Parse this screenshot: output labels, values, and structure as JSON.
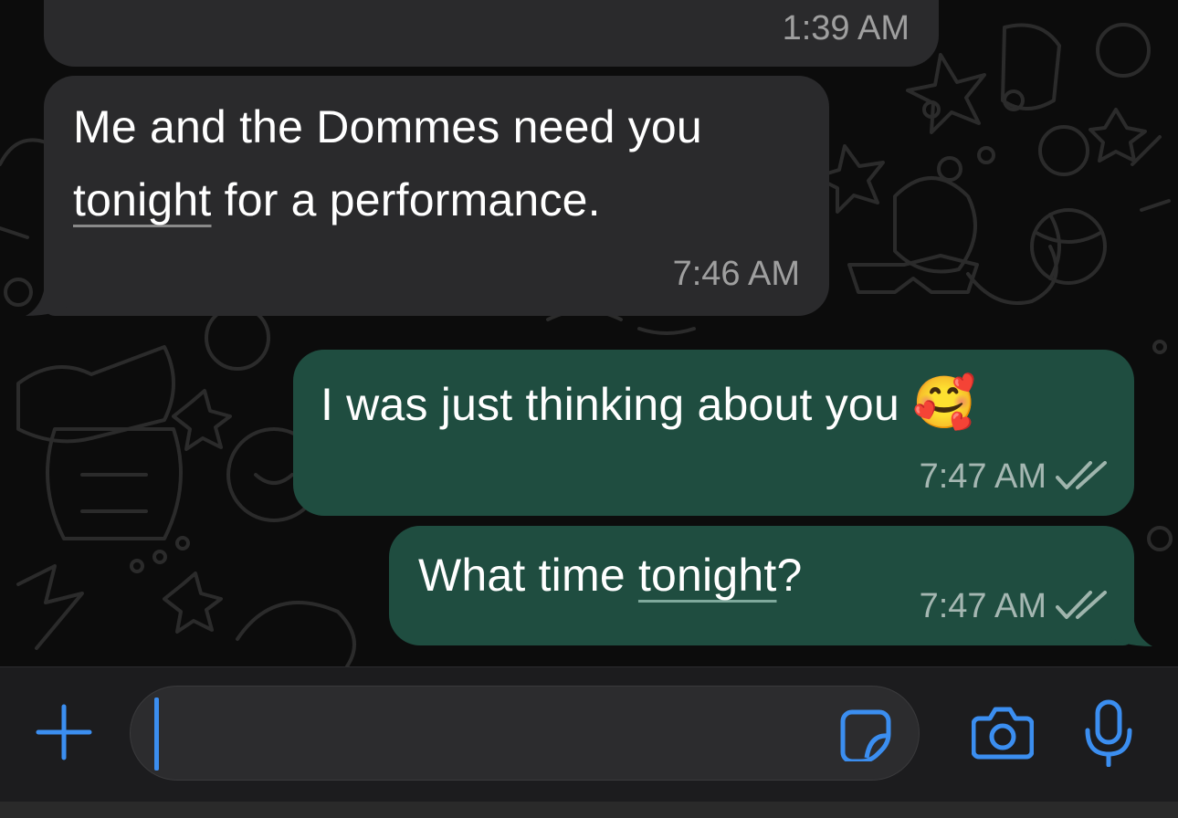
{
  "theme": {
    "incoming_bubble": "#2a2a2c",
    "outgoing_bubble": "#1f4d40",
    "accent": "#3b8ef0",
    "read_ticks": "#9fb5ad"
  },
  "messages": [
    {
      "direction": "incoming",
      "text": "",
      "time": "1:39 AM"
    },
    {
      "direction": "incoming",
      "line1": "Me and the Dommes need you",
      "line2_word": "tonight",
      "line2_rest": " for a performance.",
      "time": "7:46 AM"
    },
    {
      "direction": "outgoing",
      "text": "I was just thinking about you ",
      "emoji": "🥰",
      "time": "7:47 AM",
      "status": "read-double-check-icon"
    },
    {
      "direction": "outgoing",
      "prefix": "What time ",
      "word": "tonight",
      "suffix": "?",
      "time": "7:47 AM",
      "status": "read-double-check-icon"
    }
  ],
  "composer": {
    "attach_icon": "plus-icon",
    "input_value": "",
    "sticker_icon": "sticker-icon",
    "camera_icon": "camera-icon",
    "mic_icon": "microphone-icon"
  }
}
